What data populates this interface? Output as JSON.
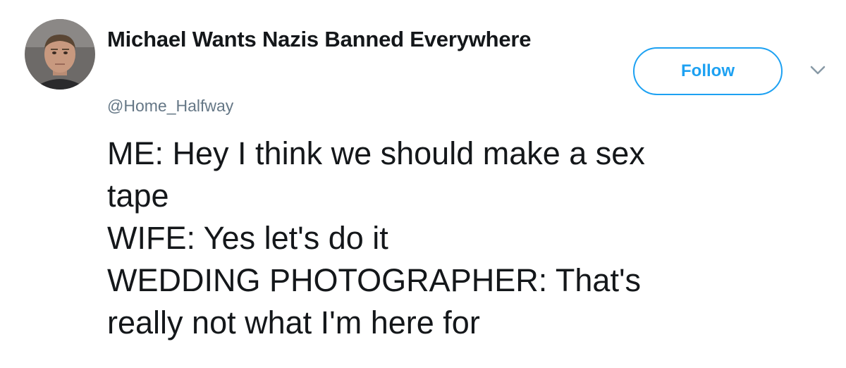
{
  "author": {
    "display_name": "Michael Wants Nazis Banned Everywhere",
    "handle": "@Home_Halfway",
    "avatar_icon": "user-photo-avatar"
  },
  "actions": {
    "follow_label": "Follow",
    "menu_icon": "chevron-down-icon"
  },
  "tweet": {
    "lines": [
      "ME: Hey I think we should make a sex",
      "tape",
      "WIFE: Yes let's do it",
      "WEDDING PHOTOGRAPHER: That's",
      "really not what I'm here for"
    ]
  },
  "colors": {
    "accent": "#1da1f2",
    "text": "#14171a",
    "secondary_text": "#657786"
  }
}
